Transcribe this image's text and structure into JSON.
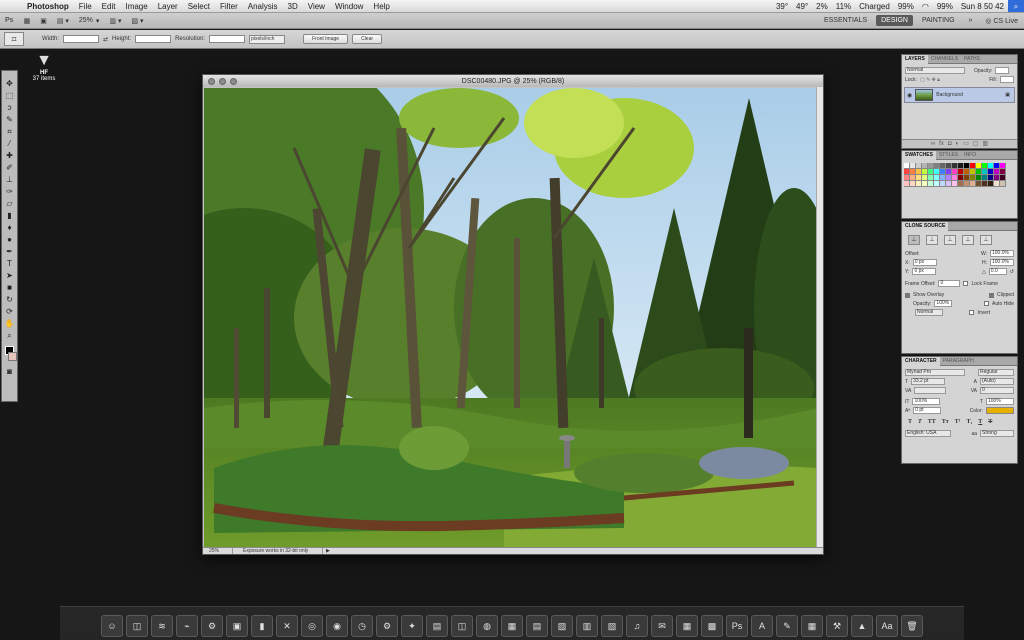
{
  "menubar": {
    "app_name": "Photoshop",
    "menus": [
      "File",
      "Edit",
      "Image",
      "Layer",
      "Select",
      "Filter",
      "Analysis",
      "3D",
      "View",
      "Window",
      "Help"
    ],
    "temp1": "39°",
    "temp2": "49°",
    "cpu": "2%",
    "net": "11%",
    "battery_status": "Charged",
    "battery_pct": "99%",
    "battery_pct2": "99%",
    "clock": "Sun 8 50 42"
  },
  "appbar": {
    "zoom": "25%",
    "workspaces": [
      "ESSENTIALS",
      "DESIGN",
      "PAINTING"
    ],
    "active_workspace": "DESIGN",
    "cs_live": "CS Live"
  },
  "options": {
    "width_label": "Width:",
    "height_label": "Height:",
    "resolution_label": "Resolution:",
    "units": "pixels/inch",
    "front_image": "Front Image",
    "clear": "Clear"
  },
  "desktop_item": {
    "label": "HF",
    "count": "37 items"
  },
  "document": {
    "title": "DSC00480.JPG @ 25% (RGB/8)",
    "zoom": "25%",
    "status_info": "Exposure works in 32-bit only"
  },
  "layers_panel": {
    "tabs": [
      "LAYERS",
      "CHANNELS",
      "PATHS"
    ],
    "blend_mode": "Normal",
    "opacity_label": "Opacity:",
    "lock_label": "Lock:",
    "fill_label": "Fill:",
    "layer_name": "Background"
  },
  "swatches_panel": {
    "tabs": [
      "SWATCHES",
      "STYLES",
      "INFO"
    ],
    "colors": [
      "#ffffff",
      "#e6e6e6",
      "#cccccc",
      "#b3b3b3",
      "#999999",
      "#808080",
      "#666666",
      "#4d4d4d",
      "#333333",
      "#1a1a1a",
      "#000000",
      "#ff0000",
      "#ffff00",
      "#00ff00",
      "#00ffff",
      "#0000ff",
      "#ff00ff",
      "#ff4040",
      "#ff8040",
      "#ffc040",
      "#c0ff40",
      "#40ff80",
      "#40ffff",
      "#4080ff",
      "#8040ff",
      "#ff40c0",
      "#c00000",
      "#c06000",
      "#c0c000",
      "#00c000",
      "#00c0c0",
      "#0000c0",
      "#c000c0",
      "#800040",
      "#ff8080",
      "#ffb080",
      "#ffe080",
      "#e0ff80",
      "#80ffb0",
      "#80ffff",
      "#80b0ff",
      "#b080ff",
      "#ff80e0",
      "#800000",
      "#804000",
      "#808000",
      "#008000",
      "#008080",
      "#000080",
      "#800080",
      "#400020",
      "#ffc0c0",
      "#ffd8c0",
      "#fff0c0",
      "#f0ffc0",
      "#c0ffd8",
      "#c0ffff",
      "#c0d8ff",
      "#d8c0ff",
      "#ffc0f0",
      "#a07050",
      "#c09070",
      "#e0b090",
      "#705030",
      "#503020",
      "#302010",
      "#f0e0d0",
      "#d0c0b0"
    ]
  },
  "clone_panel": {
    "tab": "CLONE SOURCE",
    "offset_label": "Offset:",
    "x_value": "0 px",
    "y_value": "0 px",
    "w_value": "100.0%",
    "h_value": "100.0%",
    "angle_value": "0.0",
    "frame_offset_label": "Frame Offset:",
    "frame_offset_value": "0",
    "lock_frame": "Lock Frame",
    "show_overlay": "Show Overlay",
    "clipped": "Clipped",
    "opacity_label": "Opacity:",
    "opacity_value": "100%",
    "auto_hide": "Auto Hide",
    "mode": "Normal",
    "invert": "Invert"
  },
  "character_panel": {
    "tabs": [
      "CHARACTER",
      "PARAGRAPH"
    ],
    "font": "Myriad Pro",
    "style": "Regular",
    "size": "33.2 pt",
    "leading": "(Auto)",
    "tracking": "0",
    "vscale": "100%",
    "hscale": "100%",
    "baseline": "0 pt",
    "color_label": "Color:",
    "color_value": "#e8b000",
    "language": "English: USA",
    "antialias": "Strong"
  },
  "dock": {
    "items": [
      "Finder",
      "Grab",
      "Activity Monitor",
      "Console",
      "System Preferences",
      "Disk Utility",
      "Terminal",
      "X11",
      "Safari",
      "Network",
      "Clock",
      "Automator",
      "Growl",
      "Preview",
      "Image Capture",
      "Globe",
      "Calendar",
      "Notes",
      "Photos",
      "Reader",
      "Books",
      "iTunes",
      "Mail",
      "Numbers",
      "Keynote",
      "Photoshop",
      "Acrobat",
      "Pages",
      "Calculator",
      "Xcode",
      "Sweeper",
      "Dictionary",
      "Trash"
    ]
  }
}
